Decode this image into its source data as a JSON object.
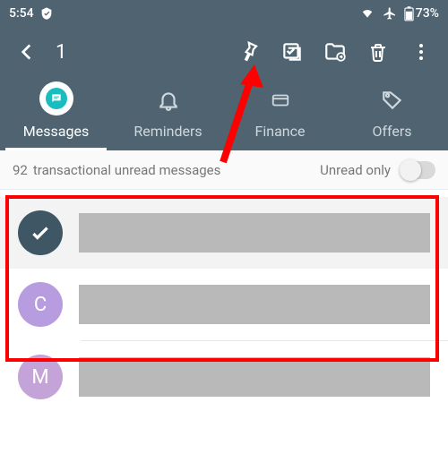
{
  "status": {
    "time": "5:54",
    "battery": "73%"
  },
  "toolbar": {
    "selection_count": "1"
  },
  "tabs": {
    "messages": "Messages",
    "reminders": "Reminders",
    "finance": "Finance",
    "offers": "Offers"
  },
  "filter": {
    "count": "92",
    "text": "transactional unread messages",
    "unread_label": "Unread only"
  },
  "rows": [
    {
      "avatar_letter": ""
    },
    {
      "avatar_letter": "C"
    },
    {
      "avatar_letter": "M"
    }
  ]
}
